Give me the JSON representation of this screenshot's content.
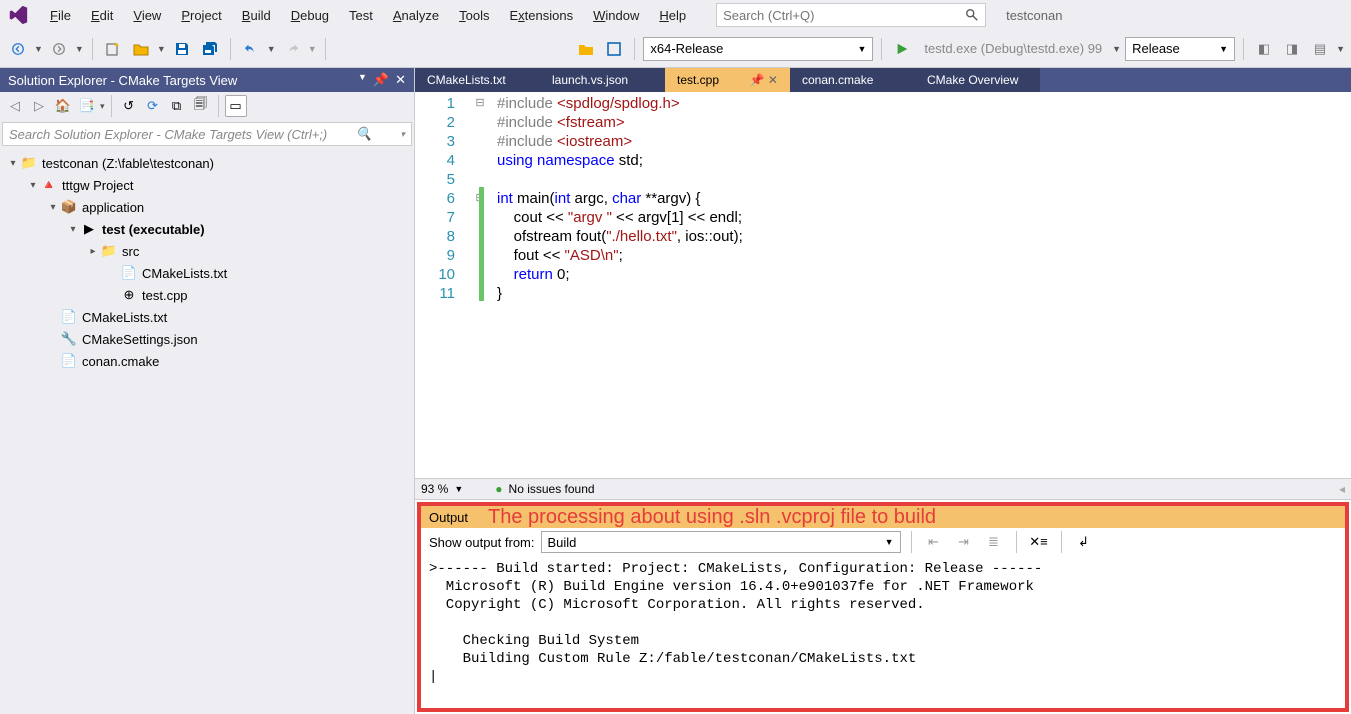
{
  "menubar": {
    "items": [
      {
        "label": "File",
        "u": "F"
      },
      {
        "label": "Edit",
        "u": "E"
      },
      {
        "label": "View",
        "u": "V"
      },
      {
        "label": "Project",
        "u": "P"
      },
      {
        "label": "Build",
        "u": "B"
      },
      {
        "label": "Debug",
        "u": "D"
      },
      {
        "label": "Test",
        "u": ""
      },
      {
        "label": "Analyze",
        "u": "A"
      },
      {
        "label": "Tools",
        "u": "T"
      },
      {
        "label": "Extensions",
        "u": "x"
      },
      {
        "label": "Window",
        "u": "W"
      },
      {
        "label": "Help",
        "u": "H"
      }
    ],
    "search_placeholder": "Search (Ctrl+Q)",
    "solution": "testconan"
  },
  "toolbar": {
    "config": "x64-Release",
    "run": "testd.exe (Debug\\testd.exe) 99",
    "release": "Release"
  },
  "sidebar": {
    "title": "Solution Explorer - CMake Targets View",
    "search_placeholder": "Search Solution Explorer - CMake Targets View (Ctrl+;)",
    "tree": [
      {
        "indent": 0,
        "caret": "▾",
        "icon": "folder-icon",
        "label": "testconan (Z:\\fable\\testconan)",
        "bold": false
      },
      {
        "indent": 1,
        "caret": "▾",
        "icon": "cmake-icon",
        "label": "tttgw Project",
        "bold": false
      },
      {
        "indent": 2,
        "caret": "▾",
        "icon": "app-icon",
        "label": "application",
        "bold": false
      },
      {
        "indent": 3,
        "caret": "▾",
        "icon": "exe-icon",
        "label": "test (executable)",
        "bold": true
      },
      {
        "indent": 4,
        "caret": "▸",
        "icon": "folder-icon",
        "label": "src",
        "bold": false
      },
      {
        "indent": 5,
        "caret": "",
        "icon": "file-icon",
        "label": "CMakeLists.txt",
        "bold": false
      },
      {
        "indent": 5,
        "caret": "",
        "icon": "cpp-icon",
        "label": "test.cpp",
        "bold": false
      },
      {
        "indent": 2,
        "caret": "",
        "icon": "file-icon",
        "label": "CMakeLists.txt",
        "bold": false
      },
      {
        "indent": 2,
        "caret": "",
        "icon": "json-icon",
        "label": "CMakeSettings.json",
        "bold": false
      },
      {
        "indent": 2,
        "caret": "",
        "icon": "file-icon",
        "label": "conan.cmake",
        "bold": false
      }
    ]
  },
  "tabs": [
    {
      "label": "CMakeLists.txt",
      "active": false
    },
    {
      "label": "launch.vs.json",
      "active": false
    },
    {
      "label": "test.cpp",
      "active": true
    },
    {
      "label": "conan.cmake",
      "active": false
    },
    {
      "label": "CMake Overview",
      "active": false
    }
  ],
  "code": {
    "lines": [
      {
        "n": 1,
        "fold": "⊟",
        "html": "<span class='pp'>#include </span><span class='inc'>&lt;spdlog/spdlog.h&gt;</span>"
      },
      {
        "n": 2,
        "fold": "",
        "html": "<span class='pp'>#include </span><span class='inc'>&lt;fstream&gt;</span>"
      },
      {
        "n": 3,
        "fold": "",
        "html": "<span class='pp'>#include </span><span class='inc'>&lt;iostream&gt;</span>"
      },
      {
        "n": 4,
        "fold": "",
        "html": "<span class='kw'>using</span> <span class='kw'>namespace</span> std;"
      },
      {
        "n": 5,
        "fold": "",
        "html": ""
      },
      {
        "n": 6,
        "fold": "⊟",
        "html": "<span class='kw'>int</span> main(<span class='kw'>int</span> argc, <span class='kw'>char</span> **argv) {"
      },
      {
        "n": 7,
        "fold": "",
        "html": "    cout &lt;&lt; <span class='str'>\"argv \"</span> &lt;&lt; argv[1] &lt;&lt; endl;"
      },
      {
        "n": 8,
        "fold": "",
        "html": "    ofstream fout(<span class='str'>\"./hello.txt\"</span>, ios::out);"
      },
      {
        "n": 9,
        "fold": "",
        "html": "    fout &lt;&lt; <span class='str'>\"ASD\\n\"</span>;"
      },
      {
        "n": 10,
        "fold": "",
        "html": "    <span class='kw'>return</span> 0;"
      },
      {
        "n": 11,
        "fold": "",
        "html": "}"
      }
    ]
  },
  "status": {
    "zoom": "93 %",
    "issues": "No issues found"
  },
  "output": {
    "title": "Output",
    "annotation": "The processing about using .sln .vcproj file to build",
    "from_label": "Show output from:",
    "from_value": "Build",
    "text": ">------ Build started: Project: CMakeLists, Configuration: Release ------\n  Microsoft (R) Build Engine version 16.4.0+e901037fe for .NET Framework\n  Copyright (C) Microsoft Corporation. All rights reserved.\n  \n    Checking Build System\n    Building Custom Rule Z:/fable/testconan/CMakeLists.txt\n|"
  }
}
